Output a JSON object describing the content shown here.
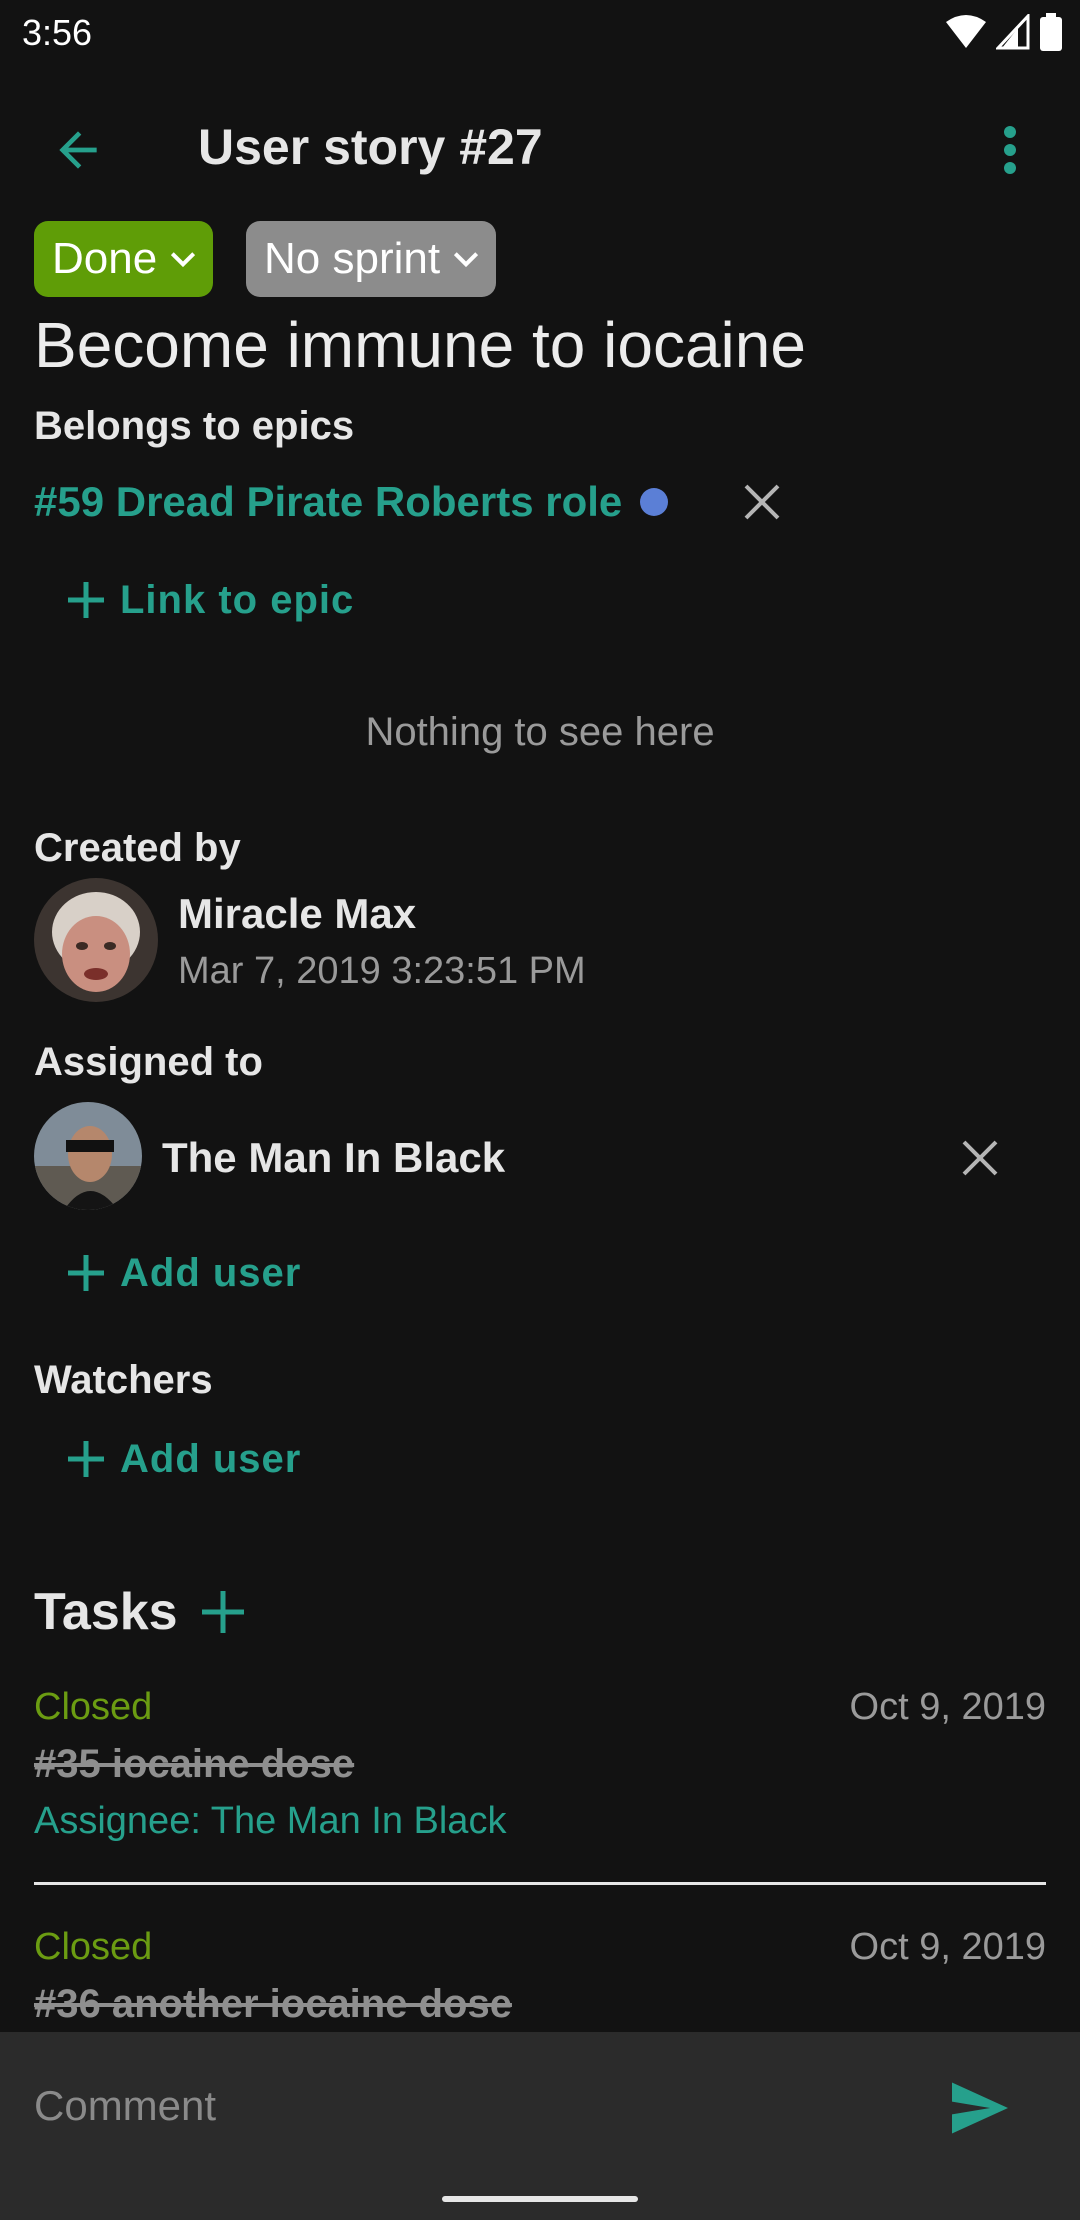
{
  "status_bar": {
    "time": "3:56",
    "icons": [
      "wifi-icon",
      "signal-icon",
      "battery-icon"
    ]
  },
  "app_bar": {
    "title": "User story #27",
    "back_icon": "arrow-back-icon",
    "menu_icon": "more-vert-icon"
  },
  "chips": {
    "status": "Done",
    "sprint": "No sprint"
  },
  "story": {
    "title": "Become immune to iocaine"
  },
  "epics": {
    "label": "Belongs to epics",
    "items": [
      {
        "text": "#59 Dread Pirate Roberts role",
        "dot_color": "#5b7fd6"
      }
    ],
    "link_action": "Link to epic"
  },
  "empty_state": "Nothing to see here",
  "created_by": {
    "label": "Created by",
    "name": "Miracle Max",
    "date": "Mar 7, 2019 3:23:51 PM"
  },
  "assigned_to": {
    "label": "Assigned to",
    "name": "The Man In Black",
    "add_action": "Add user"
  },
  "watchers": {
    "label": "Watchers",
    "add_action": "Add user"
  },
  "tasks": {
    "label": "Tasks",
    "items": [
      {
        "status": "Closed",
        "date": "Oct 9, 2019",
        "title": "#35 iocaine dose",
        "assignee": "Assignee: The Man In Black"
      },
      {
        "status": "Closed",
        "date": "Oct 9, 2019",
        "title": "#36 another iocaine dose"
      }
    ]
  },
  "comment": {
    "placeholder": "Comment",
    "send_icon": "send-icon"
  },
  "colors": {
    "accent": "#26a08c",
    "done": "#5f9d07",
    "sprint": "#8c8c8c",
    "closed": "#6b9c12",
    "background": "#121212"
  }
}
